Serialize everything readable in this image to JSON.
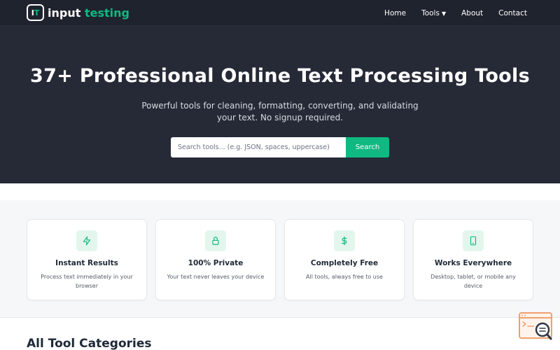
{
  "brand": {
    "mark_i": "I",
    "mark_t": "T",
    "name_main": "input",
    "name_accent": "testing",
    "accent_color": "#10b981"
  },
  "nav": {
    "items": [
      {
        "label": "Home"
      },
      {
        "label": "Tools",
        "dropdown": true
      },
      {
        "label": "About"
      },
      {
        "label": "Contact"
      }
    ]
  },
  "hero": {
    "title": "37+ Professional Online Text Processing Tools",
    "subtitle": "Powerful tools for cleaning, formatting, converting, and validating your text. No signup required.",
    "search_placeholder": "Search tools... (e.g. JSON, spaces, uppercase)",
    "search_button": "Search"
  },
  "features": [
    {
      "icon": "lightning-icon",
      "title": "Instant Results",
      "desc": "Process text immediately in your browser"
    },
    {
      "icon": "lock-icon",
      "title": "100% Private",
      "desc": "Your text never leaves your device"
    },
    {
      "icon": "dollar-icon",
      "title": "Completely Free",
      "desc": "All tools, always free to use"
    },
    {
      "icon": "mobile-icon",
      "title": "Works Everywhere",
      "desc": "Desktop, tablet, or mobile any device"
    }
  ],
  "categories": {
    "title": "All Tool Categories"
  },
  "colors": {
    "nav_bg": "#1f232e",
    "hero_bg": "#262a37",
    "accent": "#10b981",
    "helper": "#f0a070"
  }
}
